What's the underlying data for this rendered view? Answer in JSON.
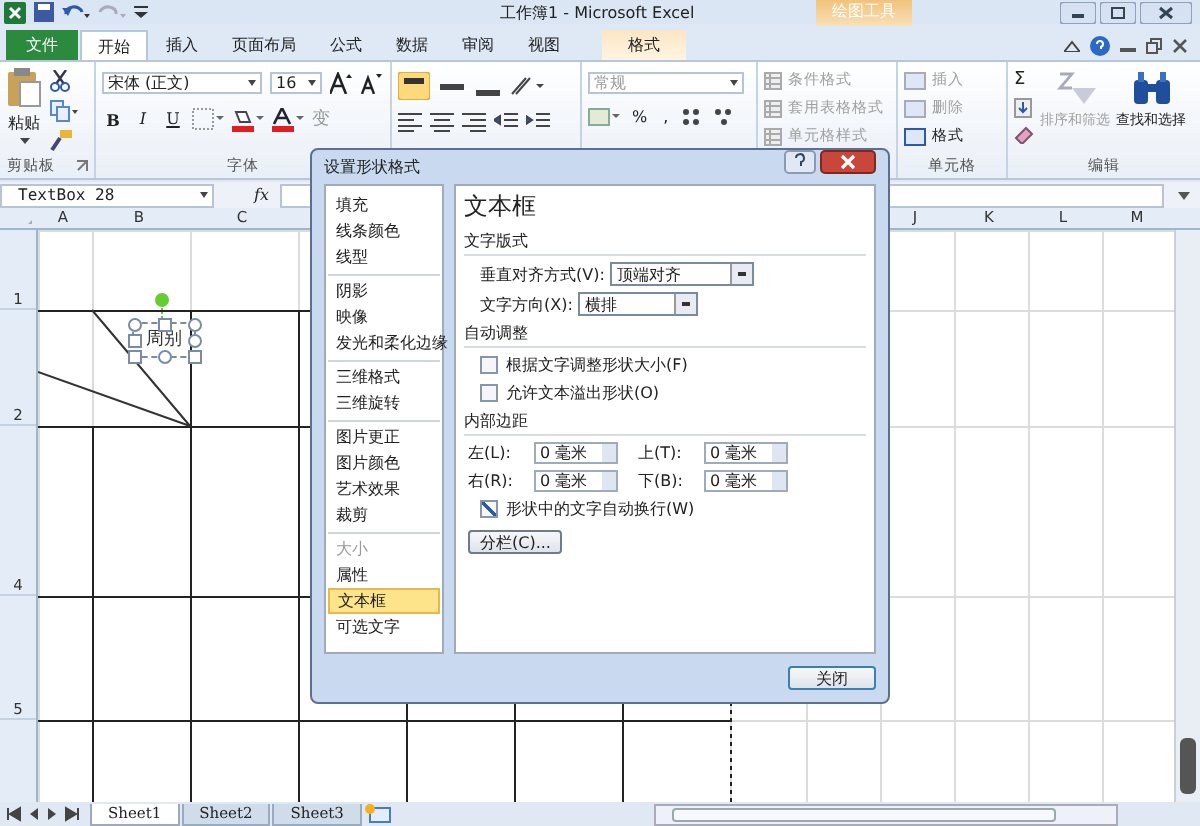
{
  "title_bar": {
    "title": "工作簿1 - Microsoft Excel",
    "context_group": "绘图工具"
  },
  "ribbon_tabs": [
    {
      "label": "文件",
      "kind": "file",
      "selected": false
    },
    {
      "label": "开始",
      "kind": "normal",
      "selected": true
    },
    {
      "label": "插入",
      "kind": "normal",
      "selected": false
    },
    {
      "label": "页面布局",
      "kind": "normal",
      "selected": false
    },
    {
      "label": "公式",
      "kind": "normal",
      "selected": false
    },
    {
      "label": "数据",
      "kind": "normal",
      "selected": false
    },
    {
      "label": "审阅",
      "kind": "normal",
      "selected": false
    },
    {
      "label": "视图",
      "kind": "normal",
      "selected": false
    },
    {
      "label": "格式",
      "kind": "context",
      "selected": false
    }
  ],
  "ribbon": {
    "clipboard": {
      "paste": "粘贴",
      "label": "剪贴板"
    },
    "font": {
      "name": "宋体 (正文)",
      "size": "16",
      "label": "字体",
      "phonetic": "变",
      "bold": "B",
      "italic": "I",
      "underline": "U"
    },
    "number": {
      "format": "常规",
      "percent": "%",
      "comma": ","
    },
    "styles": [
      {
        "label": "条件格式",
        "disabled": true
      },
      {
        "label": "套用表格格式",
        "disabled": true
      },
      {
        "label": "单元格样式",
        "disabled": true
      }
    ],
    "cells": {
      "items": [
        {
          "label": "插入",
          "disabled": true
        },
        {
          "label": "删除",
          "disabled": true
        },
        {
          "label": "格式",
          "disabled": false
        }
      ],
      "label": "单元格"
    },
    "editing": {
      "sort": {
        "label": "排序和筛选",
        "disabled": true
      },
      "find": {
        "label": "查找和选择",
        "disabled": false
      },
      "label": "编辑",
      "sum": "Σ"
    }
  },
  "formula_bar": {
    "name_box": "TextBox 28",
    "fx": "fx"
  },
  "column_headers": [
    "A",
    "B",
    "C",
    "J",
    "K",
    "L",
    "M"
  ],
  "row_headers": [
    "1",
    "2",
    "4",
    "5"
  ],
  "text_box": {
    "text": "周别"
  },
  "sheet_tabs": [
    {
      "label": "Sheet1",
      "selected": true
    },
    {
      "label": "Sheet2",
      "selected": false
    },
    {
      "label": "Sheet3",
      "selected": false
    }
  ],
  "dialog": {
    "title": "设置形状格式",
    "categories": [
      {
        "label": "填充",
        "divider_before": false,
        "disabled": false,
        "selected": false
      },
      {
        "label": "线条颜色",
        "divider_before": false,
        "disabled": false,
        "selected": false
      },
      {
        "label": "线型",
        "divider_before": false,
        "disabled": false,
        "selected": false
      },
      {
        "label": "阴影",
        "divider_before": true,
        "disabled": false,
        "selected": false
      },
      {
        "label": "映像",
        "divider_before": false,
        "disabled": false,
        "selected": false
      },
      {
        "label": "发光和柔化边缘",
        "divider_before": false,
        "disabled": false,
        "selected": false
      },
      {
        "label": "三维格式",
        "divider_before": true,
        "disabled": false,
        "selected": false
      },
      {
        "label": "三维旋转",
        "divider_before": false,
        "disabled": false,
        "selected": false
      },
      {
        "label": "图片更正",
        "divider_before": true,
        "disabled": false,
        "selected": false
      },
      {
        "label": "图片颜色",
        "divider_before": false,
        "disabled": false,
        "selected": false
      },
      {
        "label": "艺术效果",
        "divider_before": false,
        "disabled": false,
        "selected": false
      },
      {
        "label": "裁剪",
        "divider_before": false,
        "disabled": false,
        "selected": false
      },
      {
        "label": "大小",
        "divider_before": true,
        "disabled": true,
        "selected": false
      },
      {
        "label": "属性",
        "divider_before": false,
        "disabled": false,
        "selected": false
      },
      {
        "label": "文本框",
        "divider_before": false,
        "disabled": false,
        "selected": true
      },
      {
        "label": "可选文字",
        "divider_before": false,
        "disabled": false,
        "selected": false
      }
    ],
    "heading": "文本框",
    "layout_section": "文字版式",
    "vertical_align": {
      "label": "垂直对齐方式(V):",
      "value": "顶端对齐"
    },
    "direction": {
      "label": "文字方向(X):",
      "value": "横排"
    },
    "autofit_section": "自动调整",
    "autofit_options": [
      {
        "label": "根据文字调整形状大小(F)",
        "checked": false
      },
      {
        "label": "允许文本溢出形状(O)",
        "checked": false
      }
    ],
    "margins_section": "内部边距",
    "margins": [
      {
        "label": "左(L):",
        "value": "0 毫米"
      },
      {
        "label": "上(T):",
        "value": "0 毫米"
      },
      {
        "label": "右(R):",
        "value": "0 毫米"
      },
      {
        "label": "下(B):",
        "value": "0 毫米"
      }
    ],
    "wrap": {
      "label": "形状中的文字自动换行(W)",
      "checked": true
    },
    "columns_button": "分栏(C)...",
    "close_button": "关闭"
  }
}
